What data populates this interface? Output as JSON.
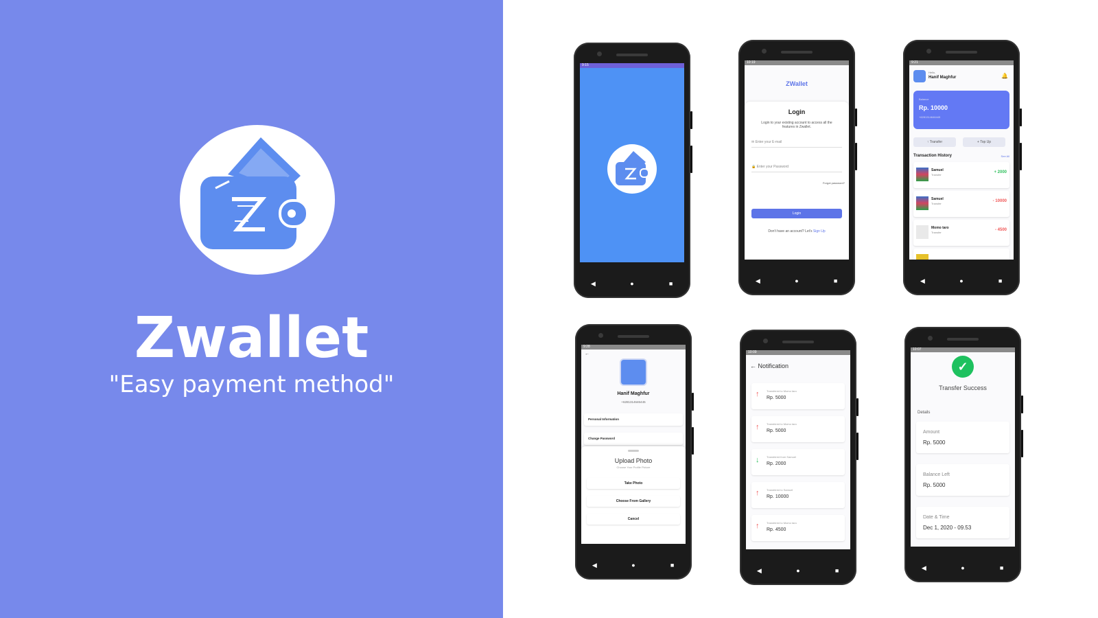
{
  "brand": {
    "title": "Zwallet",
    "tagline": "\"Easy payment method\"",
    "panel_color": "#7789EB",
    "logo_color": "#5D8DEF"
  },
  "phones": {
    "splash": {
      "status": "9:15"
    },
    "login": {
      "status": "10:19",
      "app_name": "ZWallet",
      "heading": "Login",
      "subtext": "Login to your existing account to access all the features in Zwallet.",
      "email_placeholder": "Enter your E-mail",
      "password_placeholder": "Enter your Password",
      "forgot": "Forgot password?",
      "button": "Login",
      "signup_prompt": "Don't have an account? Let's",
      "signup_link": "Sign Up"
    },
    "home": {
      "status": "9:21",
      "greeting": "Hello,",
      "user_name": "Hanif Maghfur",
      "balance_label": "Balance",
      "balance_value": "Rp. 10000",
      "phone": "+6281314646445",
      "transfer_btn": "Transfer",
      "topup_btn": "Top Up",
      "history_title": "Transaction History",
      "see_all": "See All",
      "transactions": [
        {
          "name": "Samuel",
          "type": "Transfer",
          "amount": "+ 2000",
          "color": "#2EBF5C"
        },
        {
          "name": "Samuel",
          "type": "Transfer",
          "amount": "- 10000",
          "color": "#F05656"
        },
        {
          "name": "Momo taro",
          "type": "Transfer",
          "amount": "- 4500",
          "color": "#F05656"
        }
      ]
    },
    "profile": {
      "status": "9:28",
      "name": "Hanif Maghfur",
      "phone": "+6281314646445",
      "personal_info": "Personal Information",
      "change_password": "Change Password",
      "upload_title": "Upload Photo",
      "upload_sub": "Choose Your Profile Picture",
      "take_photo": "Take Photo",
      "choose_gallery": "Choose From Gallery",
      "cancel": "Cancel"
    },
    "notification": {
      "status": "10:09",
      "title": "Notification",
      "items": [
        {
          "desc": "Transfered to Momo taro",
          "amount": "Rp. 5000",
          "dir": "up"
        },
        {
          "desc": "Transfered to Momo taro",
          "amount": "Rp. 5000",
          "dir": "up"
        },
        {
          "desc": "Transfered from Samuel",
          "amount": "Rp. 2000",
          "dir": "down"
        },
        {
          "desc": "Transfered to Samuel",
          "amount": "Rp. 10000",
          "dir": "up"
        },
        {
          "desc": "Transfered to Momo taro",
          "amount": "Rp. 4500",
          "dir": "up"
        }
      ]
    },
    "success": {
      "status": "10:07",
      "title": "Transfer Success",
      "details_label": "Details",
      "amount_label": "Amount",
      "amount_value": "Rp. 5000",
      "balance_label": "Balance Left",
      "balance_value": "Rp. 5000",
      "date_label": "Date & Time",
      "date_value": "Dec 1, 2020 - 09.53"
    }
  },
  "nav": {
    "back": "◀",
    "home": "●",
    "recent": "■"
  }
}
